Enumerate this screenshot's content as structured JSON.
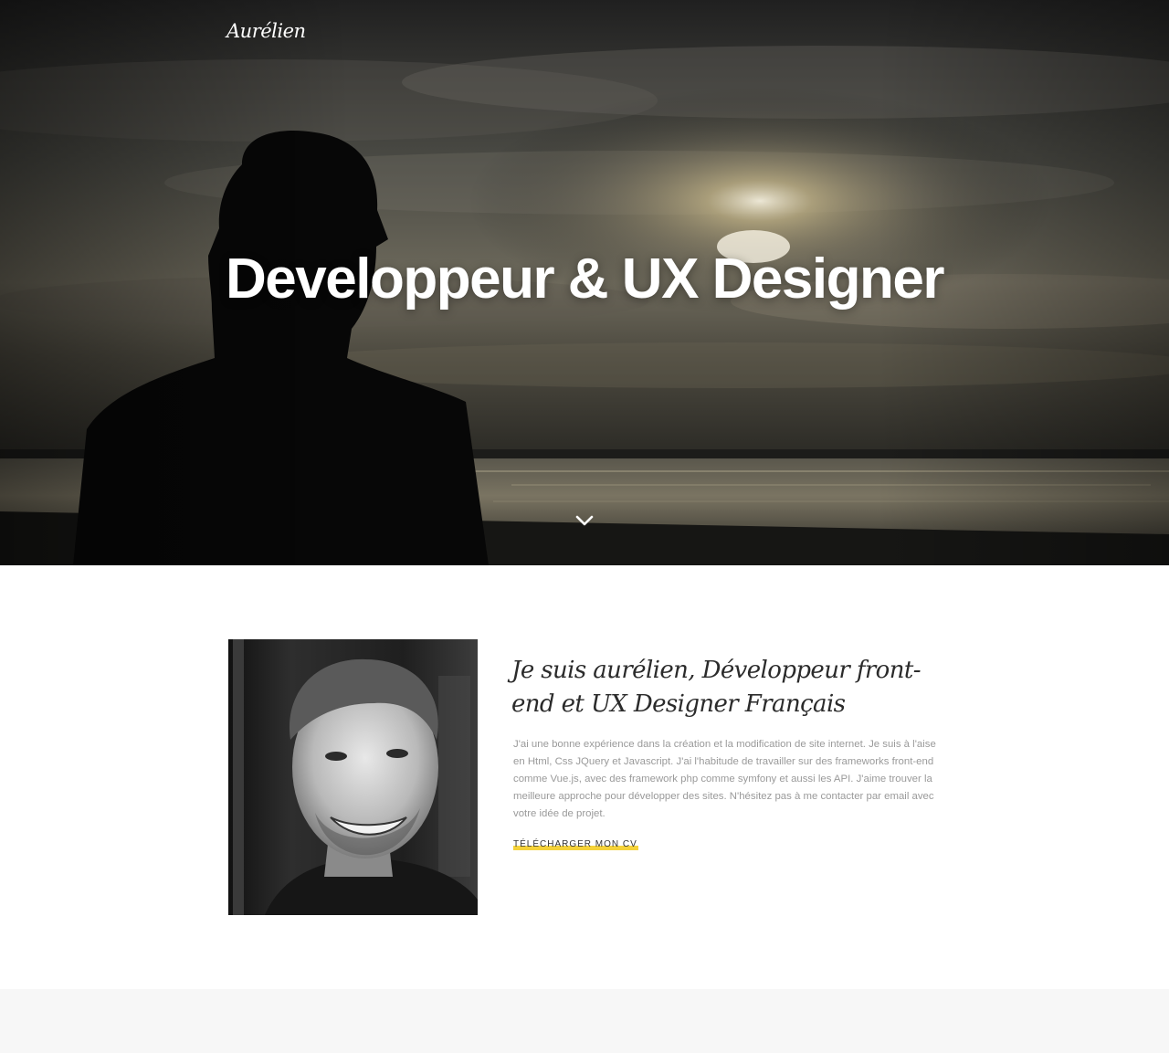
{
  "header": {
    "logo": "Aurélien"
  },
  "hero": {
    "title": "Developpeur & UX Designer",
    "scroll_icon": "chevron-down-icon"
  },
  "about": {
    "heading": "Je suis aurélien, Développeur front-end et UX Designer Français",
    "text": "J'ai une bonne expérience dans la création et la modification de site internet. Je suis à l'aise en Html, Css JQuery et Javascript. J'ai l'habitude de travailler sur des frameworks front-end comme Vue.js, avec des framework php comme symfony et aussi les API. J'aime trouver la meilleure approche pour développer des sites. N'hésitez pas à me contacter par email avec votre idée de projet.",
    "cv_link": "TÉLÉCHARGER MON CV"
  },
  "colors": {
    "accent": "#f5d23a",
    "heading": "#2b2b2b",
    "body_text": "#9a9a9a",
    "section_bg": "#f7f7f7"
  }
}
